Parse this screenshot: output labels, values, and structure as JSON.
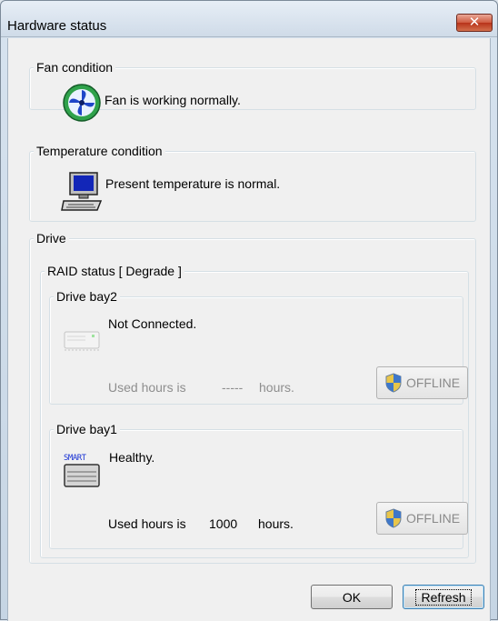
{
  "window": {
    "title": "Hardware status",
    "close_glyph": "✕"
  },
  "fan": {
    "group_label": "Fan condition",
    "status": "Fan is working normally.",
    "icon": "fan-icon"
  },
  "temperature": {
    "group_label": "Temperature condition",
    "status": "Present temperature is normal.",
    "icon": "computer-icon"
  },
  "drive": {
    "group_label": "Drive",
    "raid_label": "RAID status [ Degrade ]",
    "bays": [
      {
        "label": "Drive bay2",
        "status": "Not Connected.",
        "used_prefix": "Used hours is",
        "used_value": "-----",
        "used_suffix": "hours.",
        "button_label": "OFFLINE",
        "enabled": false
      },
      {
        "label": "Drive bay1",
        "status": "Healthy.",
        "smart_badge": "SMART",
        "used_prefix": "Used hours is",
        "used_value": "1000",
        "used_suffix": "hours.",
        "button_label": "OFFLINE",
        "enabled": false
      }
    ]
  },
  "buttons": {
    "ok": "OK",
    "refresh": "Refresh"
  }
}
